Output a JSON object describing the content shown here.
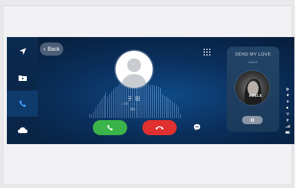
{
  "nav": {
    "items": [
      {
        "name": "navigation",
        "icon": "navigation-arrow-icon"
      },
      {
        "name": "media",
        "icon": "media-folder-icon"
      },
      {
        "name": "phone",
        "icon": "phone-icon",
        "active": true
      },
      {
        "name": "cloud",
        "icon": "cloud-icon"
      }
    ]
  },
  "call": {
    "back_label": "Back",
    "caller_name": "于 旧",
    "caller_number": "186 ···· ····",
    "timer": "00:··",
    "accept_icon": "phone-icon",
    "end_icon": "phone-hangup-icon",
    "keypad_icon": "keypad-icon",
    "message_icon": "message-icon"
  },
  "music": {
    "song_title": "SEND MY LOVE",
    "artist": "ADELE",
    "album_label": "ADELE",
    "play_state": "pause"
  },
  "colors": {
    "accept": "#3ab34a",
    "end": "#e0302f",
    "background": "#0a2f5c"
  },
  "status_icons": [
    "bluetooth-icon",
    "mic-icon",
    "usb-icon",
    "volume-icon",
    "wifi-icon",
    "bluetooth-small-icon",
    "signal-icon",
    "battery-icon"
  ]
}
